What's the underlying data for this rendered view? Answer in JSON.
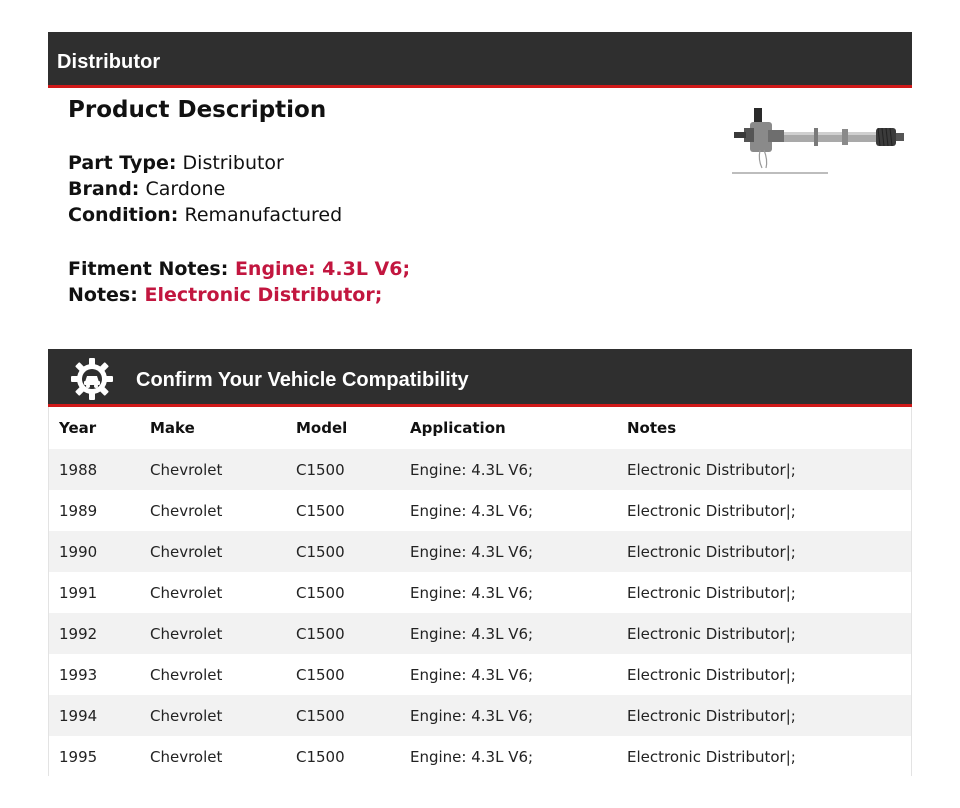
{
  "product": {
    "category_title": "Distributor",
    "description_heading": "Product Description",
    "specs": [
      {
        "label": "Part Type:",
        "value": "Distributor"
      },
      {
        "label": "Brand:",
        "value": "Cardone"
      },
      {
        "label": "Condition:",
        "value": "Remanufactured"
      }
    ],
    "fitment": [
      {
        "label": "Fitment Notes:",
        "value": "Engine: 4.3L V6;"
      },
      {
        "label": "Notes:",
        "value": "Electronic Distributor;"
      }
    ],
    "image_icon": "distributor-part-photo"
  },
  "compatibility": {
    "title": "Confirm Your Vehicle Compatibility",
    "icon": "gear-car-icon",
    "columns": [
      "Year",
      "Make",
      "Model",
      "Application",
      "Notes"
    ],
    "rows": [
      [
        "1988",
        "Chevrolet",
        "C1500",
        "Engine: 4.3L V6;",
        "Electronic Distributor|;"
      ],
      [
        "1989",
        "Chevrolet",
        "C1500",
        "Engine: 4.3L V6;",
        "Electronic Distributor|;"
      ],
      [
        "1990",
        "Chevrolet",
        "C1500",
        "Engine: 4.3L V6;",
        "Electronic Distributor|;"
      ],
      [
        "1991",
        "Chevrolet",
        "C1500",
        "Engine: 4.3L V6;",
        "Electronic Distributor|;"
      ],
      [
        "1992",
        "Chevrolet",
        "C1500",
        "Engine: 4.3L V6;",
        "Electronic Distributor|;"
      ],
      [
        "1993",
        "Chevrolet",
        "C1500",
        "Engine: 4.3L V6;",
        "Electronic Distributor|;"
      ],
      [
        "1994",
        "Chevrolet",
        "C1500",
        "Engine: 4.3L V6;",
        "Electronic Distributor|;"
      ],
      [
        "1995",
        "Chevrolet",
        "C1500",
        "Engine: 4.3L V6;",
        "Electronic Distributor|;"
      ]
    ]
  },
  "colors": {
    "header_bg": "#2f2f2f",
    "accent_red": "#d01919",
    "fitment_value": "#c2163f",
    "row_stripe": "#f2f2f2"
  }
}
